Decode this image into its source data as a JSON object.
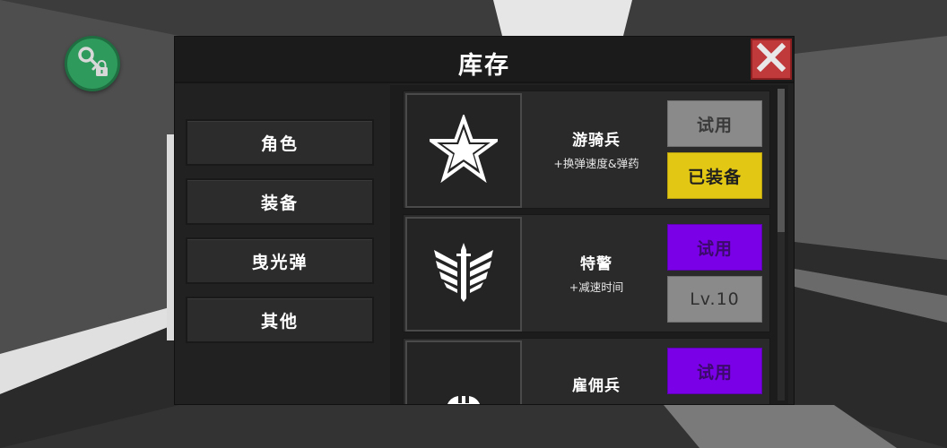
{
  "panel": {
    "title": "库存"
  },
  "categories": [
    {
      "label": "角色"
    },
    {
      "label": "装备"
    },
    {
      "label": "曳光弹"
    },
    {
      "label": "其他"
    }
  ],
  "items": [
    {
      "name": "游骑兵",
      "desc": "+换弹速度&弹药",
      "icon": "star-icon",
      "buttons": [
        {
          "label": "试用",
          "style": "gray"
        },
        {
          "label": "已装备",
          "style": "yellow"
        }
      ]
    },
    {
      "name": "特警",
      "desc": "+减速时间",
      "icon": "winged-sword-icon",
      "buttons": [
        {
          "label": "试用",
          "style": "purple"
        },
        {
          "label": "Lv.10",
          "style": "level"
        }
      ]
    },
    {
      "name": "雇佣兵",
      "desc": "",
      "icon": "helmet-icon",
      "buttons": [
        {
          "label": "试用",
          "style": "purple"
        }
      ]
    }
  ],
  "colors": {
    "close": "#c0393b",
    "equipped": "#e2c814",
    "trial_locked": "#7a00e8",
    "trial": "#8a8a8a",
    "key_badge": "#2e9a5c"
  },
  "icons": {
    "key_badge": "key-lock-icon",
    "close": "close-icon"
  }
}
